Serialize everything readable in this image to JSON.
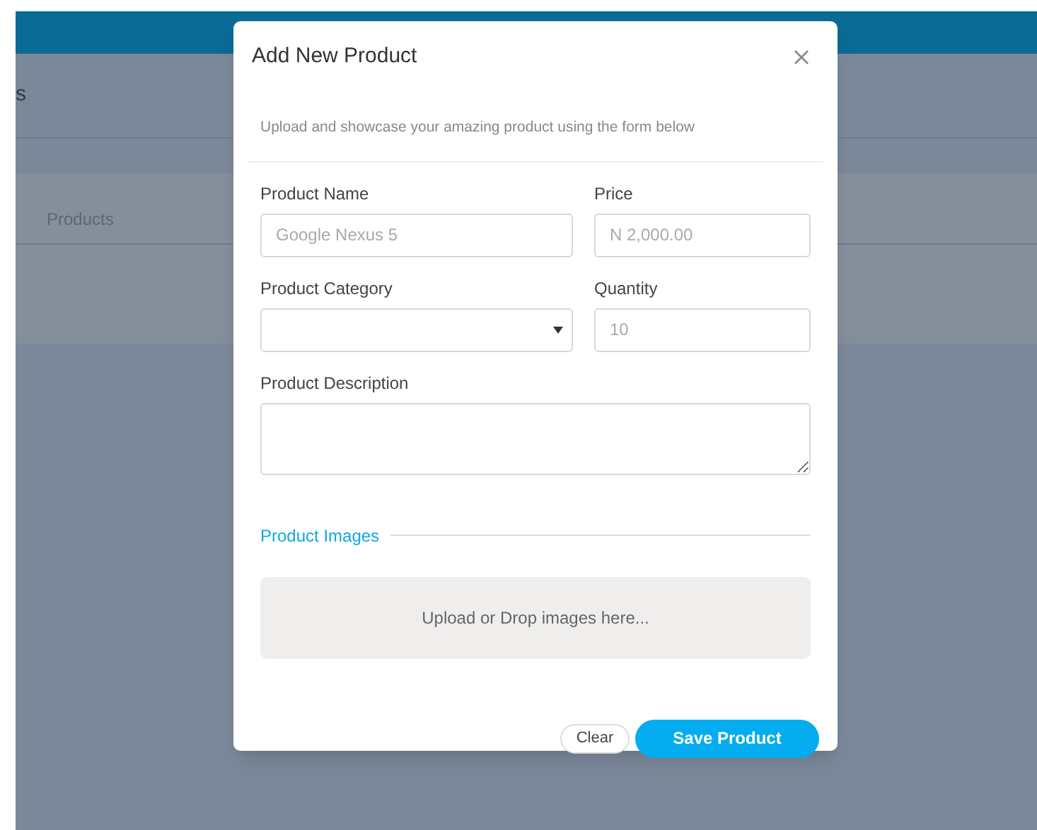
{
  "background": {
    "heading_fragment": "s",
    "tab": "Products"
  },
  "modal": {
    "title": "Add New Product",
    "subtitle": "Upload and showcase your amazing product using the form below",
    "fields": [
      {
        "kind": "text",
        "label": "Product Name",
        "placeholder": "Google Nexus 5"
      },
      {
        "kind": "text",
        "label": "Price",
        "placeholder": "N 2,000.00"
      },
      {
        "kind": "select",
        "label": "Product Category"
      },
      {
        "kind": "text",
        "label": "Quantity",
        "placeholder": "10"
      },
      {
        "kind": "textarea",
        "label": "Product Description"
      }
    ],
    "images_section": "Product Images",
    "dropzone": "Upload or Drop images here...",
    "buttons": [
      {
        "kind": "secondary",
        "label": "Clear"
      },
      {
        "kind": "primary",
        "label": "Save Product"
      }
    ]
  }
}
